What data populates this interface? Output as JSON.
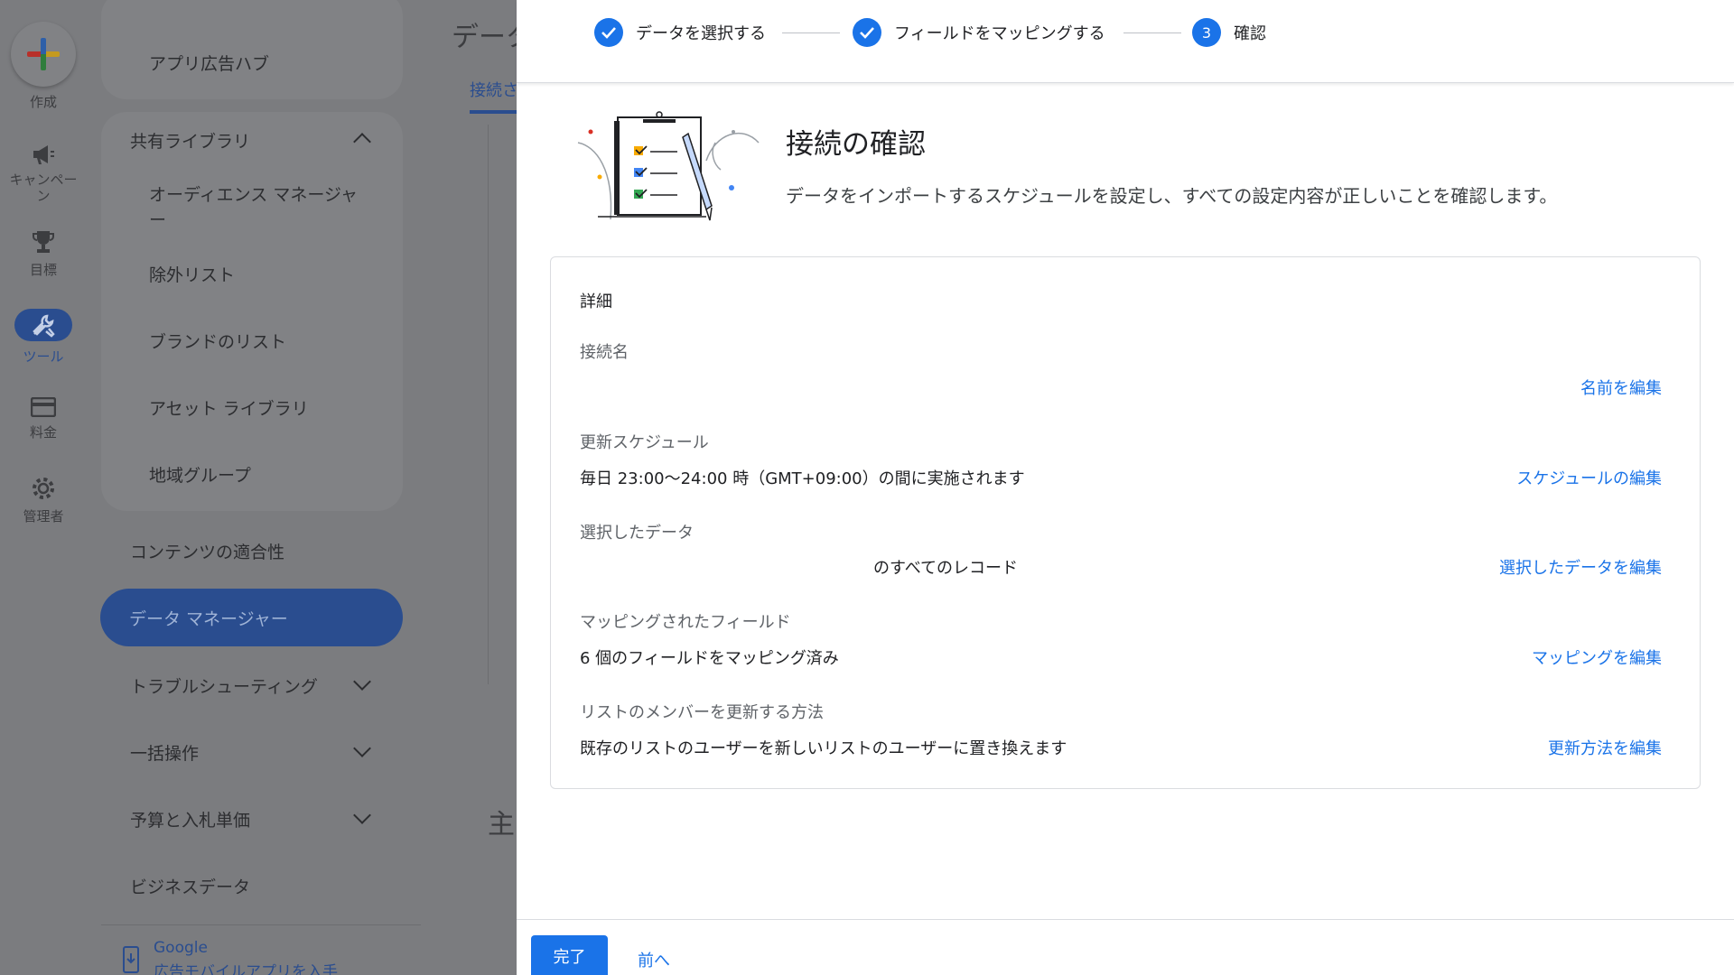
{
  "rail": {
    "create_label": "作成",
    "campaign_label": "キャンペーン",
    "goals_label": "目標",
    "tools_label": "ツール",
    "billing_label": "料金",
    "admin_label": "管理者"
  },
  "nav": {
    "app_ads_hub": "アプリ広告ハブ",
    "shared_library": "共有ライブラリ",
    "audience_manager": "オーディエンス マネージャー",
    "exclusion_lists": "除外リスト",
    "brand_lists": "ブランドのリスト",
    "asset_library": "アセット ライブラリ",
    "location_groups": "地域グループ",
    "content_suitability": "コンテンツの適合性",
    "data_manager": "データ マネージャー",
    "troubleshooting": "トラブルシューティング",
    "bulk_actions": "一括操作",
    "budgets_bids": "予算と入札単価",
    "business_data": "ビジネスデータ",
    "promo_brand": "Google",
    "promo_text": "広告モバイルアプリを入手"
  },
  "background": {
    "page_title_partial": "データ",
    "tab_partial": "接続さ",
    "section_partial": "主"
  },
  "stepper": {
    "steps": [
      {
        "label": "データを選択する",
        "state": "done"
      },
      {
        "label": "フィールドをマッピングする",
        "state": "done"
      },
      {
        "label": "確認",
        "state": "current",
        "number": "3"
      }
    ]
  },
  "header": {
    "title": "接続の確認",
    "description": "データをインポートするスケジュールを設定し、すべての設定内容が正しいことを確認します。"
  },
  "details": {
    "heading": "詳細",
    "connection_name_label": "接続名",
    "connection_name_value": "",
    "edit_name": "名前を編集",
    "schedule_label": "更新スケジュール",
    "schedule_value": "毎日 23:00〜24:00 時（GMT+09:00）の間に実施されます",
    "edit_schedule": "スケジュールの編集",
    "selected_data_label": "選択したデータ",
    "selected_data_value": "のすべてのレコード",
    "edit_selected_data": "選択したデータを編集",
    "mapped_fields_label": "マッピングされたフィールド",
    "mapped_fields_value": "6 個のフィールドをマッピング済み",
    "edit_mapping": "マッピングを編集",
    "update_method_label": "リストのメンバーを更新する方法",
    "update_method_value": "既存のリストのユーザーを新しいリストのユーザーに置き換えます",
    "edit_update_method": "更新方法を編集"
  },
  "footer": {
    "done_label": "完了",
    "back_label": "前へ"
  },
  "colors": {
    "accent": "#1a73e8",
    "overlay": "#7b7c7f"
  }
}
